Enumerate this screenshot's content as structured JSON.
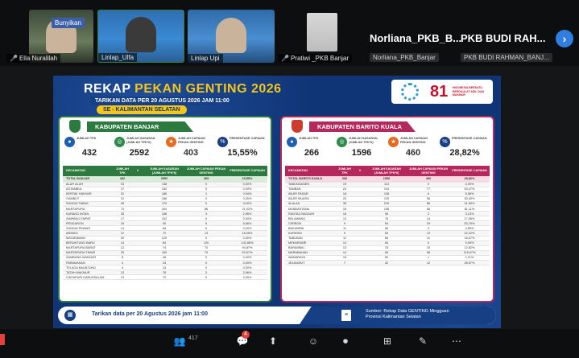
{
  "participants": [
    {
      "name": "Ella Nuralilah",
      "muted": true
    },
    {
      "name": "Linlap_Ulfa",
      "muted": false
    },
    {
      "name": "Linlap Upi",
      "muted": false
    },
    {
      "name": "Pratiwi _PKB Banjar",
      "muted": true
    },
    {
      "name": "Norliana_PKB_Banjar",
      "display": "Norliana_PKB_B...",
      "muted": false
    },
    {
      "name": "PKB BUDI RAHMAN_BANJ...",
      "display": "PKB BUDI RAH...",
      "muted": false
    }
  ],
  "unmute_badge": "Bunyikan",
  "slide": {
    "title_white": "REKAP",
    "title_yellow": "PEKAN GENTING 2026",
    "subtitle": "TARIKAN DATA PER 20 AGUSTUS 2026 JAM 11:00",
    "region": "SE - KALIMANTAN SELATAN",
    "logo_number": "81",
    "logo_text": "INDONESIA BERSATU BERDAULAT ADIL DAN MAKMUR",
    "stat_labels": [
      "JUMLAH TPK",
      "JUMLAH SASARAN (JUMLAH TPK*6)",
      "JUMLAH CAPAIAN PEKAN GENTING",
      "PRESENTASE CAPAIAN"
    ],
    "columns": [
      "KECAMATAN",
      "JUMLAH TPK",
      "#",
      "JUMLAH SASARAN (JUMLAH TPK*6)",
      "JUMLAH CAPAIAN PEKAN GENTING",
      "PRESENTASE CAPAIAN"
    ],
    "banjar": {
      "name": "KABUPATEN BANJAR",
      "stats": [
        "432",
        "2592",
        "403",
        "15,55%"
      ],
      "total": [
        "TOTAL BANJAR",
        "432",
        "",
        "2592",
        "403",
        "15,55%"
      ],
      "rows": [
        [
          "ALUH ALUH",
          "23",
          "",
          "138",
          "0",
          "0,00%"
        ],
        [
          "ASTAMBUL",
          "27",
          "",
          "162",
          "0",
          "0,00%"
        ],
        [
          "KERTAK HANYAR",
          "31",
          "",
          "186",
          "1",
          "0,54%"
        ],
        [
          "GAMBUT",
          "31",
          "",
          "186",
          "0",
          "0,00%"
        ],
        [
          "SUNGAI TABUK",
          "45",
          "",
          "270",
          "0",
          "0,00%"
        ],
        [
          "MARTAPURA",
          "74",
          "",
          "404",
          "86",
          "21,02%"
        ],
        [
          "KARANG INTAN",
          "28",
          "",
          "168",
          "3",
          "2,98%"
        ],
        [
          "SIMPANG EMPAT",
          "17",
          "",
          "102",
          "0",
          "0,00%"
        ],
        [
          "PENGARON",
          "15",
          "",
          "90",
          "5",
          "5,56%"
        ],
        [
          "SUNGAI PINANG",
          "14",
          "",
          "84",
          "0",
          "0,00%"
        ],
        [
          "ARANIO",
          "12",
          "",
          "72",
          "13",
          "18,06%"
        ],
        [
          "MATARAMAN",
          "20",
          "",
          "120",
          "0",
          "0,00%"
        ],
        [
          "BERUNTUNG BARU",
          "14",
          "",
          "84",
          "120",
          "142,86%"
        ],
        [
          "MARTAPURA BARAT",
          "12",
          "",
          "74",
          "70",
          "94,87%"
        ],
        [
          "MARTAPURA TIMUR",
          "25",
          "",
          "150",
          "79",
          "52,67%"
        ],
        [
          "SAMBUNG MAKMUR",
          "8",
          "",
          "48",
          "0",
          "0,00%"
        ],
        [
          "PARAMASAN",
          "4",
          "",
          "24",
          "0",
          "0,00%"
        ],
        [
          "TELAGA BAUNTUNG",
          "4",
          "",
          "24",
          "0",
          "0,00%"
        ],
        [
          "TATAH MAKMUR",
          "13",
          "",
          "78",
          "2",
          "2,56%"
        ],
        [
          "CINTAPURI DARUSSALAM",
          "12",
          "",
          "72",
          "0",
          "0,00%"
        ]
      ]
    },
    "batola": {
      "name": "KABUPATEN BARITO KUALA",
      "stats": [
        "266",
        "1596",
        "460",
        "28,82%"
      ],
      "total": [
        "TOTAL BARITO KUALA",
        "266",
        "",
        "1596",
        "460",
        "28,82%"
      ],
      "rows": [
        [
          "TABUNGANEN",
          "19",
          "",
          "114",
          "0",
          "0,00%"
        ],
        [
          "TAMBAN",
          "24",
          "",
          "144",
          "77",
          "53,47%"
        ],
        [
          "ANJIR PASAR",
          "18",
          "",
          "108",
          "6",
          "5,56%"
        ],
        [
          "ANJIR MUARA",
          "20",
          "",
          "120",
          "36",
          "30,00%"
        ],
        [
          "ALALAK",
          "35",
          "",
          "210",
          "88",
          "41,90%"
        ],
        [
          "MANDASTANA",
          "18",
          "",
          "108",
          "66",
          "61,11%"
        ],
        [
          "RANTAU BADAUH",
          "16",
          "",
          "96",
          "3",
          "3,13%"
        ],
        [
          "BELAWANG",
          "13",
          "",
          "78",
          "14",
          "17,95%"
        ],
        [
          "CERBON",
          "9",
          "",
          "54",
          "29",
          "53,70%"
        ],
        [
          "BAKUMPAI",
          "11",
          "",
          "66",
          "3",
          "4,55%"
        ],
        [
          "KURIPAN",
          "9",
          "",
          "54",
          "12",
          "22,22%"
        ],
        [
          "TABUKAN",
          "11",
          "",
          "66",
          "11",
          "16,67%"
        ],
        [
          "MEKARSARI",
          "14",
          "",
          "84",
          "0",
          "0,00%"
        ],
        [
          "BARAMBAI",
          "13",
          "",
          "78",
          "10",
          "12,82%"
        ],
        [
          "MARABAHAN",
          "14",
          "",
          "84",
          "98",
          "116,67%"
        ],
        [
          "WANARAYA",
          "15",
          "",
          "90",
          "1",
          "1,11%"
        ],
        [
          "JEJANGKIT",
          "7",
          "",
          "42",
          "12",
          "28,57%"
        ]
      ]
    },
    "footer_left": "Tarikan data per 20 Agustus 2026 jam 11:00",
    "footer_right_line1": "Sumber: Rekap Data GENTING Mingguan",
    "footer_right_line2": "Provinsi Kalimantan Selatan"
  },
  "toolbar": {
    "reaction_count": "417",
    "chat_badge": "4"
  }
}
